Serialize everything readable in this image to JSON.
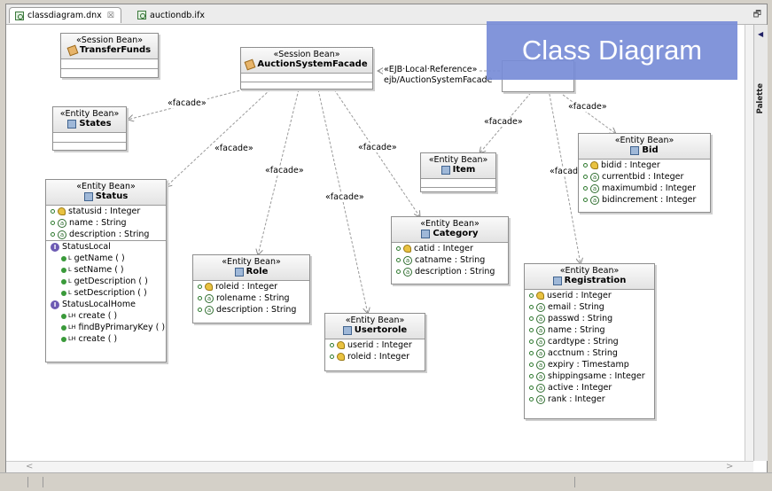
{
  "tabs": [
    {
      "label": "classdiagram.dnx",
      "close": "☒",
      "active": true
    },
    {
      "label": "auctiondb.ifx",
      "active": false
    }
  ],
  "maximize_glyph": "🗗",
  "palette": {
    "label": "Palette",
    "arrow": "◀"
  },
  "overlay_title": "Class Diagram",
  "connector_labels": {
    "facade1": "«facade»",
    "facade2": "«facade»",
    "facade3": "«facade»",
    "facade4": "«facade»",
    "facade5": "«facade»",
    "facade6": "«facade»",
    "facade7": "«facade»",
    "facade8": "«facade»",
    "facade9": "«facade»",
    "ejb_ref1": "«EJB·Local·Reference»",
    "ejb_ref2": "ejb/AuctionSystemFacade"
  },
  "boxes": {
    "transferfunds": {
      "stereotype": "«Session Bean»",
      "name": "TransferFunds"
    },
    "facade": {
      "stereotype": "«Session Bean»",
      "name": "AuctionSystemFacade"
    },
    "states": {
      "stereotype": "«Entity Bean»",
      "name": "States"
    },
    "item": {
      "stereotype": "«Entity Bean»",
      "name": "Item"
    },
    "bid": {
      "stereotype": "«Entity Bean»",
      "name": "Bid",
      "fields": [
        "bidid : Integer",
        "currentbid : Integer",
        "maximumbid : Integer",
        "bidincrement : Integer"
      ]
    },
    "status": {
      "stereotype": "«Entity Bean»",
      "name": "Status",
      "fields": [
        "statusid : Integer",
        "name : String",
        "description : String"
      ],
      "iface1": "StatusLocal",
      "iface1_methods": [
        "getName ( )",
        "setName ( )",
        "getDescription ( )",
        "setDescription ( )"
      ],
      "iface2": "StatusLocalHome",
      "iface2_methods": [
        "create ( )",
        "findByPrimaryKey ( )",
        "create ( )"
      ],
      "iface_glyph": "I",
      "method_sup_local": "L",
      "method_sup_home": "LH"
    },
    "role": {
      "stereotype": "«Entity Bean»",
      "name": "Role",
      "fields": [
        "roleid : Integer",
        "rolename : String",
        "description : String"
      ]
    },
    "usertorole": {
      "stereotype": "«Entity Bean»",
      "name": "Usertorole",
      "fields": [
        "userid : Integer",
        "roleid : Integer"
      ]
    },
    "category": {
      "stereotype": "«Entity Bean»",
      "name": "Category",
      "fields": [
        "catid : Integer",
        "catname : String",
        "description : String"
      ]
    },
    "registration": {
      "stereotype": "«Entity Bean»",
      "name": "Registration",
      "fields": [
        "userid : Integer",
        "email : String",
        "passwd : String",
        "name : String",
        "cardtype : String",
        "acctnum : String",
        "expiry : Timestamp",
        "shippingsame : Integer",
        "active : Integer",
        "rank : Integer"
      ]
    }
  },
  "attr_glyph": "a",
  "colors": {
    "overlay": "#778cd7",
    "connector": "#9a9a9a"
  }
}
